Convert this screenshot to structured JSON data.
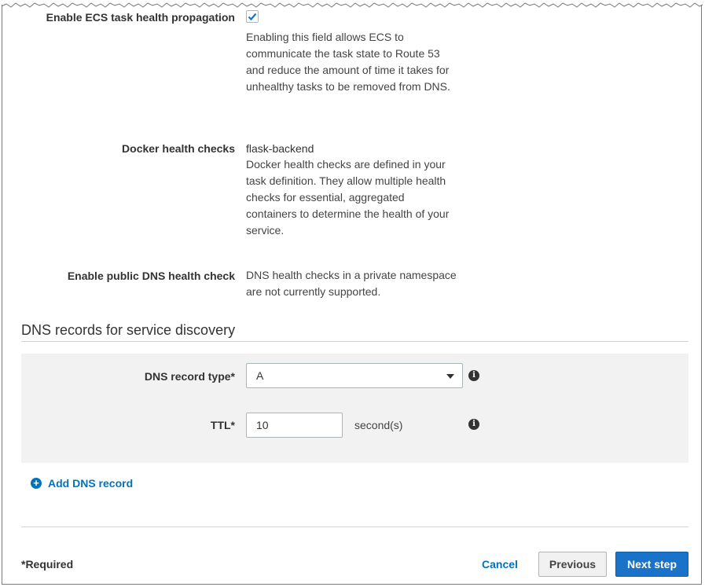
{
  "health": {
    "ecs_propagation": {
      "label": "Enable ECS task health propagation",
      "checked": true,
      "description": "Enabling this field allows ECS to communicate the task state to Route 53 and reduce the amount of time it takes for unhealthy tasks to be removed from DNS."
    },
    "docker": {
      "label": "Docker health checks",
      "value": "flask-backend",
      "description": "Docker health checks are defined in your task definition. They allow multiple health checks for essential, aggregated containers to determine the health of your service."
    },
    "public_dns": {
      "label": "Enable public DNS health check",
      "description": "DNS health checks in a private namespace are not currently supported."
    }
  },
  "dns_records": {
    "title": "DNS records for service discovery",
    "record_type_label": "DNS record type*",
    "record_type_value": "A",
    "ttl_label": "TTL*",
    "ttl_value": "10",
    "ttl_unit": "second(s)",
    "add_record": "Add DNS record"
  },
  "footer": {
    "required": "*Required",
    "cancel": "Cancel",
    "previous": "Previous",
    "next": "Next step"
  },
  "colors": {
    "link": "#0073bb",
    "primary_button": "#1a72c9",
    "panel_bg": "#f2f2f2"
  },
  "icons": [
    "checkmark-icon",
    "info-icon",
    "chevron-down-icon",
    "plus-circle-icon"
  ]
}
